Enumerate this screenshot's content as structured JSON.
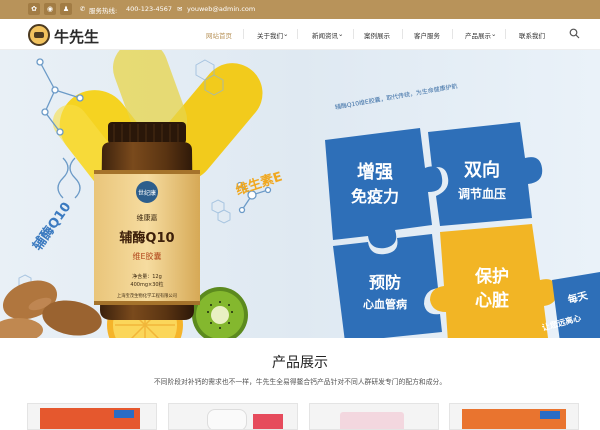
{
  "topbar": {
    "phone_label": "服务热线:",
    "phone": "400-123-4567",
    "email": "youweb@admin.com"
  },
  "brand": {
    "name": "牛先生"
  },
  "nav": {
    "items": [
      {
        "label": "网站首页",
        "active": true
      },
      {
        "label": "关于我们",
        "dropdown": true
      },
      {
        "label": "新闻资讯",
        "dropdown": true
      },
      {
        "label": "案例展示",
        "dropdown": false
      },
      {
        "label": "客户服务",
        "dropdown": false
      },
      {
        "label": "产品展示",
        "dropdown": true
      },
      {
        "label": "联系我们",
        "dropdown": false
      }
    ]
  },
  "banner": {
    "vitamin_text": "维生素E",
    "q10_text": "辅酶Q10",
    "slogan": "辅酶Q10维E胶囊，取代传统，为生命健康护航",
    "bottle": {
      "brand": "世纪康",
      "line1": "维康嘉",
      "name": "辅酶Q10",
      "sub": "维E胶囊",
      "spec1": "净含量：12g",
      "spec2": "400mg×30粒",
      "maker": "上海宝茂生物化学工程有限公司"
    },
    "puzzles": [
      {
        "line1": "增强",
        "line2": "免疫力"
      },
      {
        "line1": "双向",
        "line2": "调节血压"
      },
      {
        "line1": "预防",
        "line2": "心血管病"
      },
      {
        "line1": "保护",
        "line2": "心脏"
      }
    ],
    "side_text1": "每天",
    "side_text2": "让您远离心"
  },
  "products": {
    "title": "产品展示",
    "desc": "不同阶段对补钙的需求也不一样，牛先生全易得鳌合钙产品针对不同人群研发专门的配方和成分。"
  },
  "colors": {
    "accent": "#b8935a",
    "puzzle_blue": "#2e6fb8",
    "puzzle_yellow": "#f2b525"
  }
}
